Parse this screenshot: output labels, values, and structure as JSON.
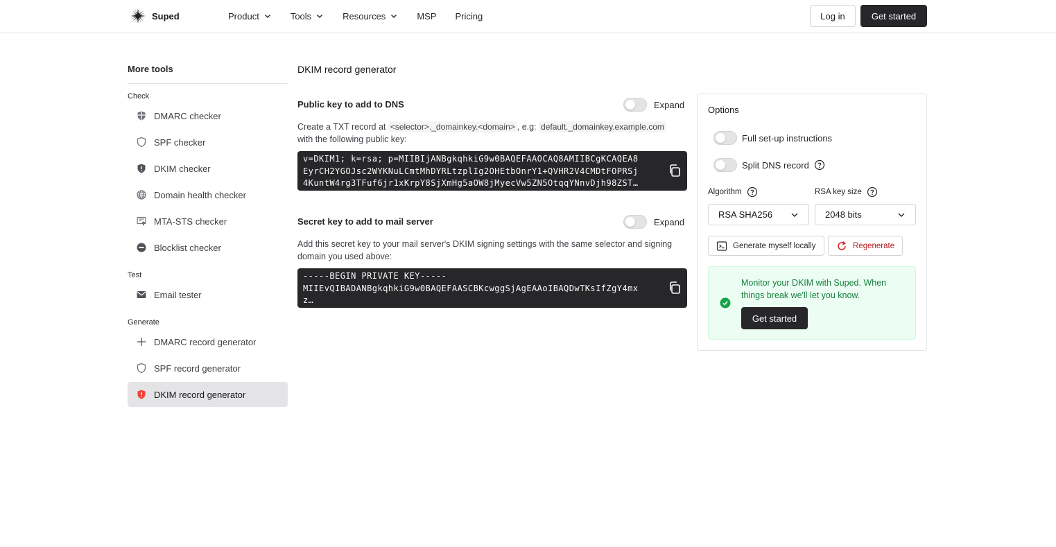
{
  "header": {
    "brand": "Suped",
    "nav": [
      {
        "label": "Product",
        "dropdown": true
      },
      {
        "label": "Tools",
        "dropdown": true
      },
      {
        "label": "Resources",
        "dropdown": true
      },
      {
        "label": "MSP",
        "dropdown": false
      },
      {
        "label": "Pricing",
        "dropdown": false
      }
    ],
    "login_label": "Log in",
    "get_started_label": "Get started"
  },
  "sidebar": {
    "title": "More tools",
    "groups": [
      {
        "label": "Check",
        "items": [
          {
            "label": "DMARC checker",
            "icon": "dmarc-shield-icon"
          },
          {
            "label": "SPF checker",
            "icon": "shield-outline-icon"
          },
          {
            "label": "DKIM checker",
            "icon": "shield-filled-icon"
          },
          {
            "label": "Domain health checker",
            "icon": "globe-icon"
          },
          {
            "label": "MTA-STS checker",
            "icon": "certificate-icon"
          },
          {
            "label": "Blocklist checker",
            "icon": "blocked-icon"
          }
        ]
      },
      {
        "label": "Test",
        "items": [
          {
            "label": "Email tester",
            "icon": "mail-icon"
          }
        ]
      },
      {
        "label": "Generate",
        "items": [
          {
            "label": "DMARC record generator",
            "icon": "plus-icon"
          },
          {
            "label": "SPF record generator",
            "icon": "shield-outline-icon"
          },
          {
            "label": "DKIM record generator",
            "icon": "shield-red-icon",
            "active": true
          }
        ]
      }
    ]
  },
  "main": {
    "title": "DKIM record generator",
    "public": {
      "title": "Public key to add to DNS",
      "expand_label": "Expand",
      "desc_1": "Create a TXT record at ",
      "code_1": "<selector>._domainkey.<domain>",
      "desc_2": ", e.g: ",
      "code_2": "default._domainkey.example.com",
      "desc_3": "with the following public key:",
      "key_lines": [
        "v=DKIM1; k=rsa; p=MIIBIjANBgkqhkiG9w0BAQEFAAOCAQ8AMIIBCgKCAQEA8",
        "EyrCH2YGOJsc2WYKNuLCmtMhDYRLtzplIg2OHEtbOnrY1+QVHR2V4CMDtFOPRSj",
        "4KuntW4rg3TFuf6jr1xKrpY8SjXmHg5aOW8jMyecVw5ZN5OtqqYNnvDjh98ZST…"
      ]
    },
    "secret": {
      "title": "Secret key to add to mail server",
      "expand_label": "Expand",
      "desc": "Add this secret key to your mail server's DKIM signing settings with the same selector and signing domain you used above:",
      "key_lines": [
        "-----BEGIN PRIVATE KEY-----",
        "MIIEvQIBADANBgkqhkiG9w0BAQEFAASCBKcwggSjAgEAAoIBAQDwTKsIfZgY4mx",
        "z…"
      ]
    }
  },
  "options": {
    "title": "Options",
    "full_setup_label": "Full set-up instructions",
    "split_dns_label": "Split DNS record",
    "algorithm_label": "Algorithm",
    "algorithm_value": "RSA SHA256",
    "keysize_label": "RSA key size",
    "keysize_value": "2048 bits",
    "generate_local_label": "Generate myself locally",
    "regenerate_label": "Regenerate",
    "promo_text": "Monitor your DKIM with Suped. When things break we'll let you know.",
    "promo_button": "Get started"
  },
  "colors": {
    "accent_dark": "#27272a",
    "danger": "#b91c1c",
    "success": "#15803d",
    "active_shield": "#f04438"
  }
}
